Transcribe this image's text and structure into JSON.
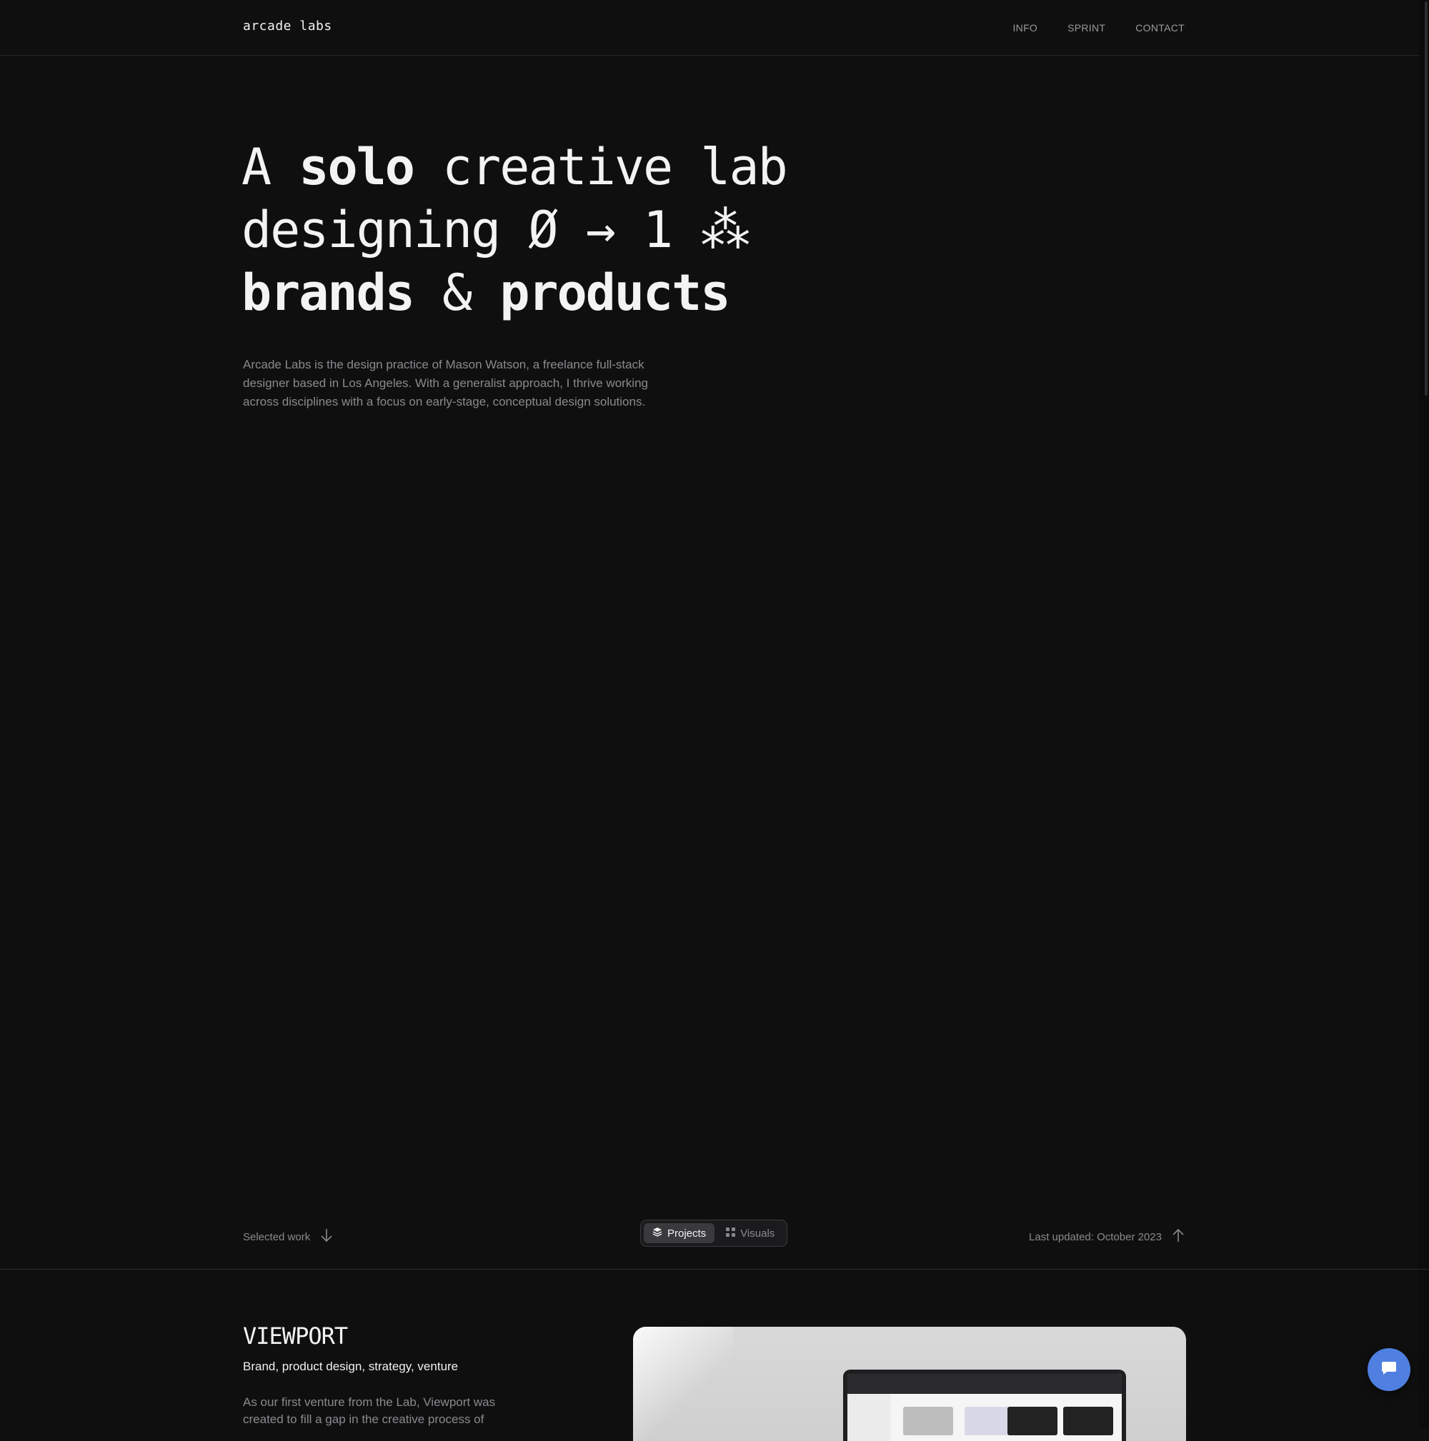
{
  "header": {
    "logo": "arcade labs",
    "nav": [
      "INFO",
      "SPRINT",
      "CONTACT"
    ]
  },
  "hero": {
    "line1_a": "A ",
    "line1_bold": "solo",
    "line1_b": " creative lab",
    "line2": "designing Ø → 1 ⁂",
    "line3_bold_a": "brands",
    "line3_amp": " & ",
    "line3_bold_b": "products",
    "intro": "Arcade Labs is the design practice of Mason Watson, a freelance full-stack designer based in Los Angeles. With a generalist approach, I thrive working across disciplines with a focus on early-stage, conceptual design solutions."
  },
  "workbar": {
    "selected_work": "Selected work",
    "toggle": [
      "Projects",
      "Visuals"
    ],
    "active_toggle": "Projects",
    "last_updated": "Last updated: October 2023"
  },
  "project": {
    "title": "VIEWPORT",
    "tags": "Brand, product design, strategy, venture",
    "description": "As our first venture from the Lab, Viewport was created to fill a gap in the creative process of"
  },
  "colors": {
    "background": "#0f0f10",
    "accent": "#4f7fe0",
    "muted_text": "#8a8a8e"
  },
  "icons": {
    "selected_work": "arrow-down-icon",
    "projects_tab": "layers-icon",
    "visuals_tab": "grid-icon",
    "last_updated": "arrow-up-icon",
    "chat": "chat-bubble-icon"
  }
}
